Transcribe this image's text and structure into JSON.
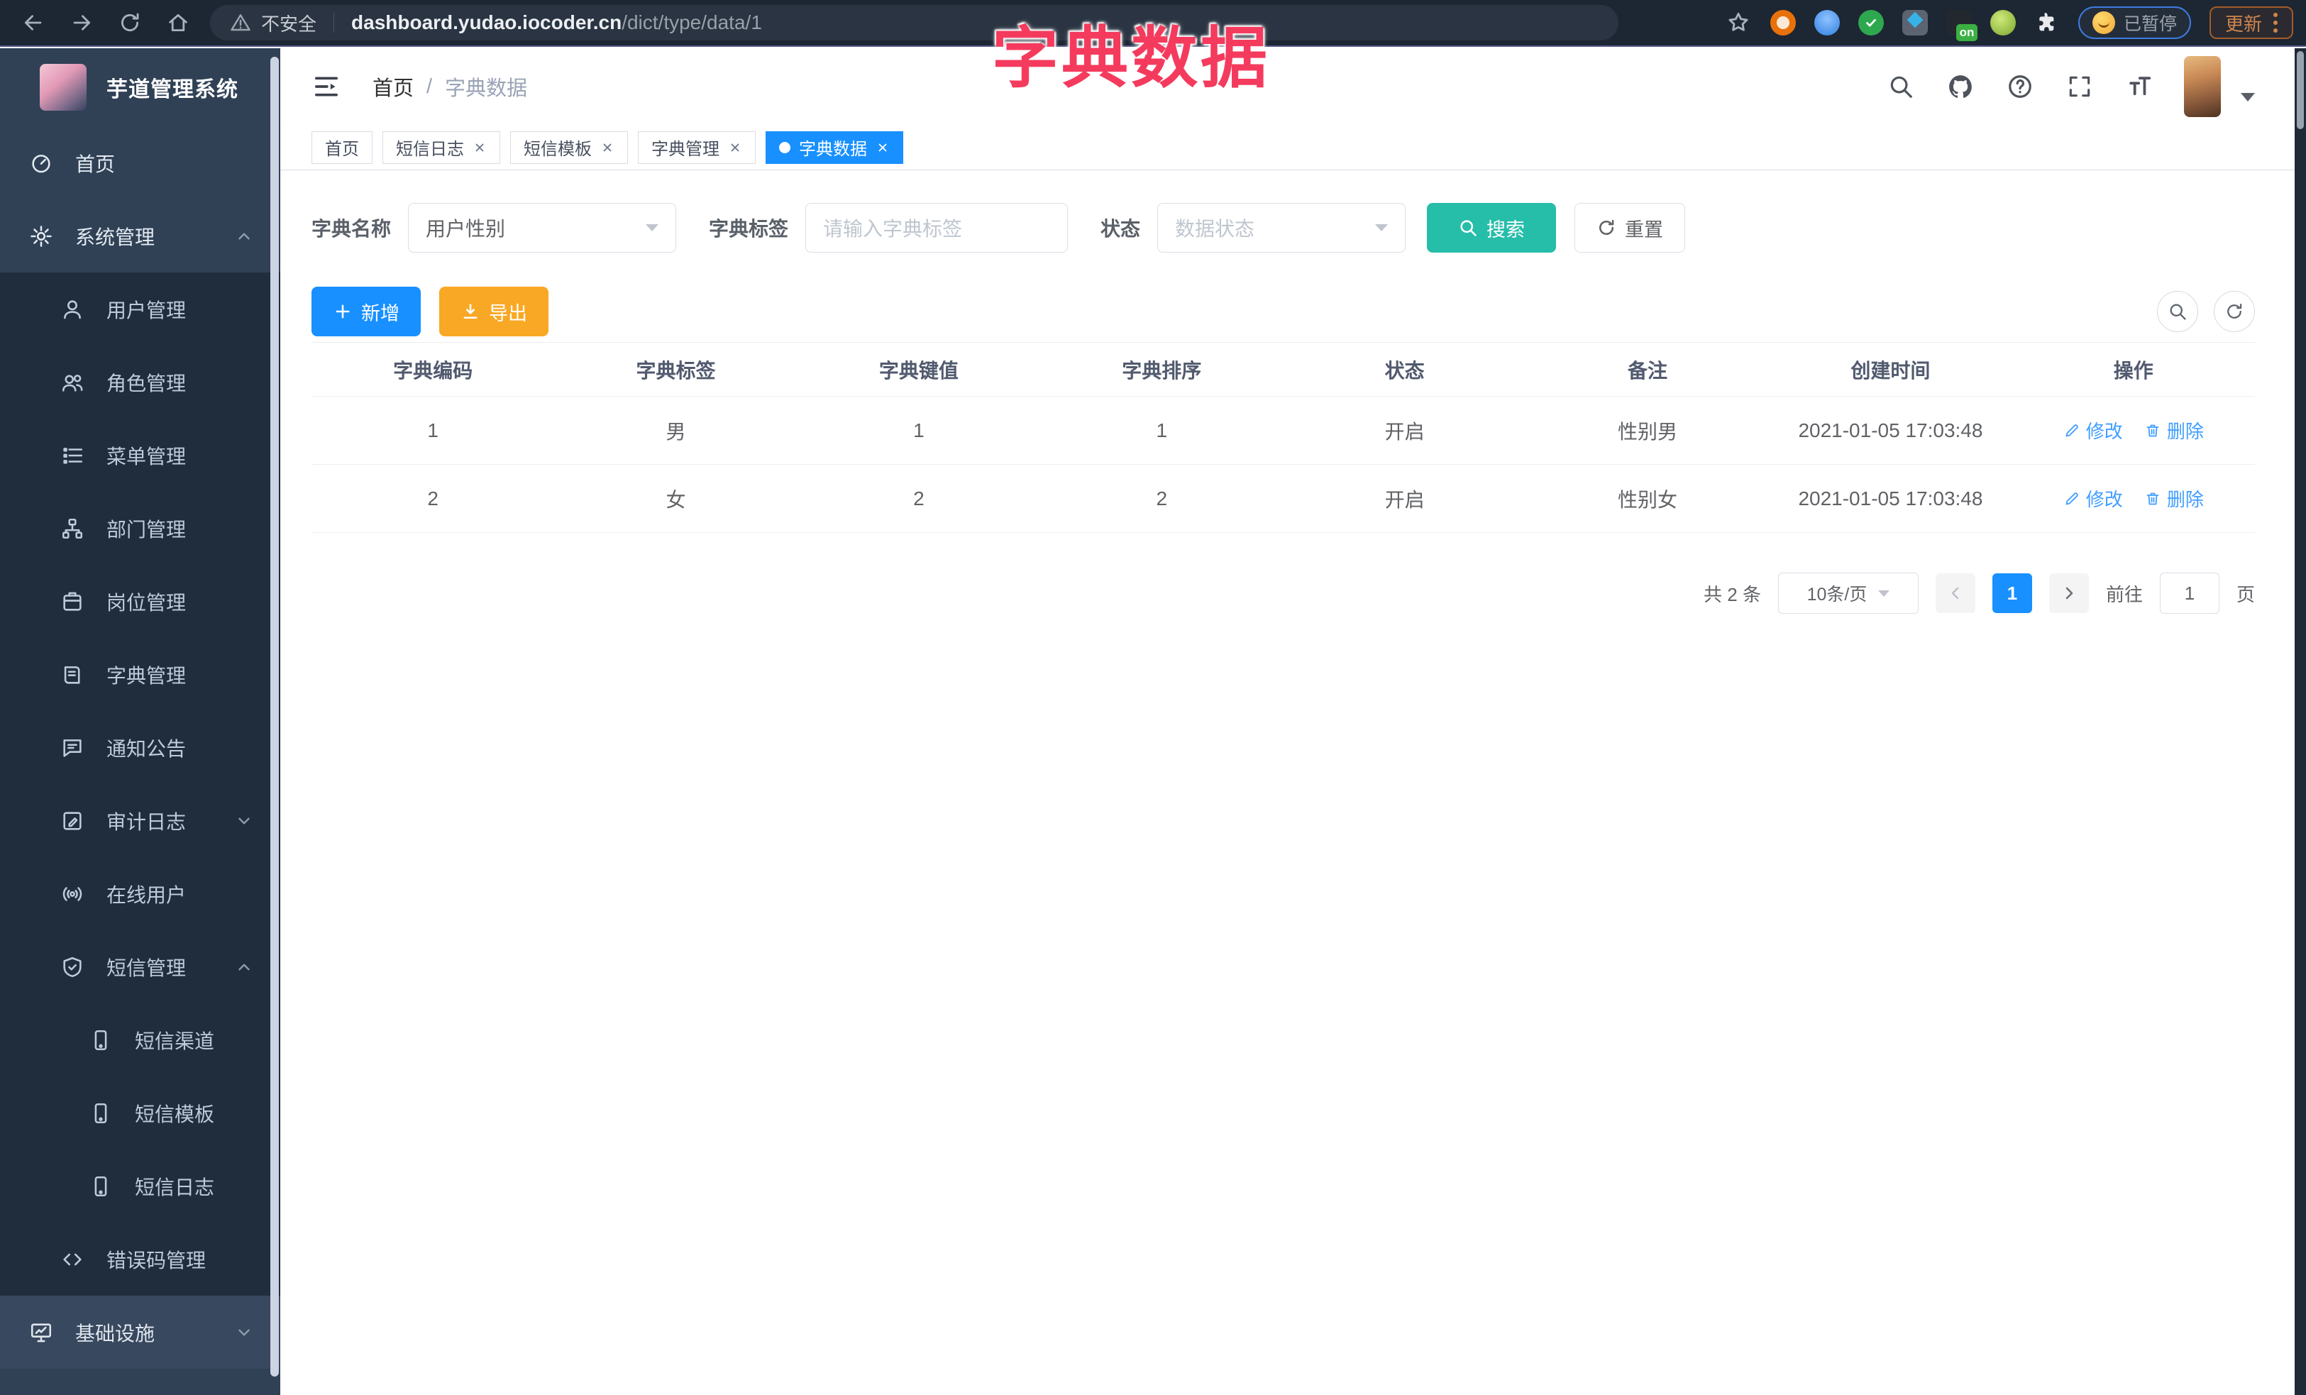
{
  "browser": {
    "security_label": "不安全",
    "url_host": "dashboard.yudao.iocoder.cn",
    "url_path": "/dict/type/data/1",
    "ext_on_badge": "on",
    "paused_label": "已暂停",
    "update_label": "更新"
  },
  "overlay_title": "字典数据",
  "sidebar": {
    "logo_title": "芋道管理系统",
    "items": [
      {
        "label": "首页"
      },
      {
        "label": "系统管理"
      },
      {
        "label": "用户管理"
      },
      {
        "label": "角色管理"
      },
      {
        "label": "菜单管理"
      },
      {
        "label": "部门管理"
      },
      {
        "label": "岗位管理"
      },
      {
        "label": "字典管理"
      },
      {
        "label": "通知公告"
      },
      {
        "label": "审计日志"
      },
      {
        "label": "在线用户"
      },
      {
        "label": "短信管理"
      },
      {
        "label": "短信渠道"
      },
      {
        "label": "短信模板"
      },
      {
        "label": "短信日志"
      },
      {
        "label": "错误码管理"
      },
      {
        "label": "基础设施"
      }
    ]
  },
  "breadcrumb": {
    "home": "首页",
    "sep": "/",
    "current": "字典数据"
  },
  "tags": {
    "items": [
      {
        "label": "首页"
      },
      {
        "label": "短信日志"
      },
      {
        "label": "短信模板"
      },
      {
        "label": "字典管理"
      },
      {
        "label": "字典数据"
      }
    ]
  },
  "filters": {
    "dict_name_label": "字典名称",
    "dict_name_value": "用户性别",
    "dict_label_label": "字典标签",
    "dict_label_placeholder": "请输入字典标签",
    "status_label": "状态",
    "status_placeholder": "数据状态",
    "search_label": "搜索",
    "reset_label": "重置"
  },
  "toolbar": {
    "add_label": "新增",
    "export_label": "导出"
  },
  "table": {
    "columns": [
      "字典编码",
      "字典标签",
      "字典键值",
      "字典排序",
      "状态",
      "备注",
      "创建时间",
      "操作"
    ],
    "rows": [
      {
        "code": "1",
        "label": "男",
        "value": "1",
        "sort": "1",
        "status": "开启",
        "remark": "性别男",
        "created": "2021-01-05 17:03:48"
      },
      {
        "code": "2",
        "label": "女",
        "value": "2",
        "sort": "2",
        "status": "开启",
        "remark": "性别女",
        "created": "2021-01-05 17:03:48"
      }
    ],
    "edit_label": "修改",
    "delete_label": "删除"
  },
  "pagination": {
    "total_text": "共 2 条",
    "page_size": "10条/页",
    "current_page": "1",
    "goto_label": "前往",
    "goto_value": "1",
    "unit_label": "页"
  }
}
